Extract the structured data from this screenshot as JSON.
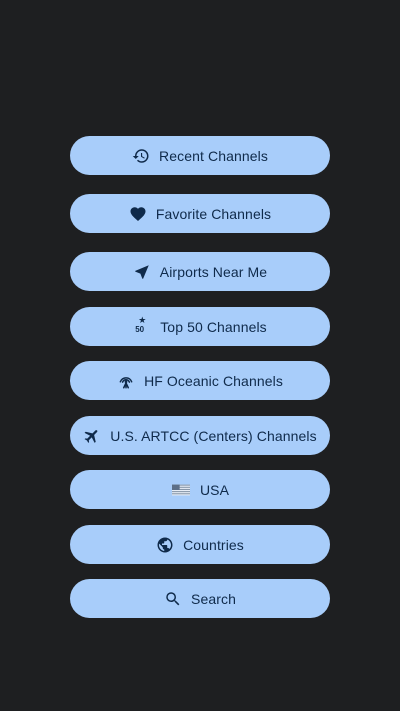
{
  "menu": {
    "items": [
      {
        "label": "Recent Channels",
        "icon": "history-icon"
      },
      {
        "label": "Favorite Channels",
        "icon": "heart-icon"
      },
      {
        "label": "Airports Near Me",
        "icon": "navigation-arrow-icon"
      },
      {
        "label": "Top 50 Channels",
        "icon": "top-50-icon",
        "icon_text": "50"
      },
      {
        "label": "HF Oceanic Channels",
        "icon": "antenna-icon"
      },
      {
        "label": "U.S. ARTCC (Centers) Channels",
        "icon": "airplane-icon"
      },
      {
        "label": "USA",
        "icon": "us-flag-icon"
      },
      {
        "label": "Countries",
        "icon": "globe-icon"
      },
      {
        "label": "Search",
        "icon": "search-icon"
      }
    ]
  },
  "colors": {
    "background": "#1e1f21",
    "button_fill": "#a8cdfa",
    "button_text": "#0f2a4a"
  }
}
